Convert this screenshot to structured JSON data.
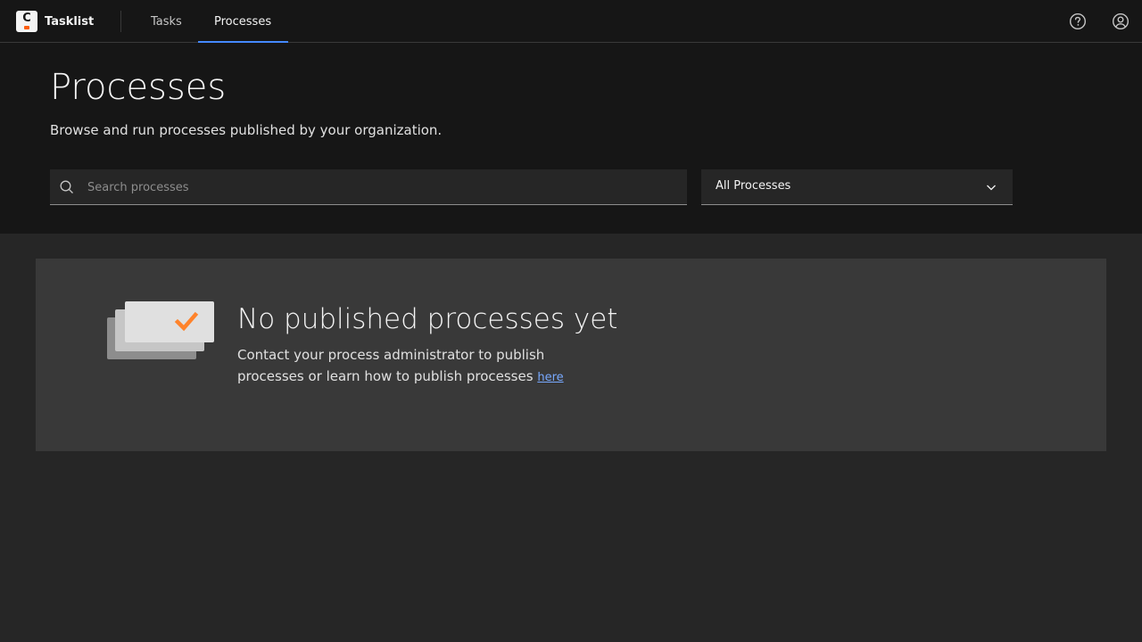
{
  "header": {
    "brand_letter": "C",
    "brand_name": "Tasklist",
    "tabs": [
      {
        "label": "Tasks",
        "active": false
      },
      {
        "label": "Processes",
        "active": true
      }
    ],
    "help_icon": "help-circle-icon",
    "user_icon": "user-avatar-icon"
  },
  "title_section": {
    "title": "Processes",
    "subtitle": "Browse and run processes published by your organization.",
    "search": {
      "placeholder": "Search processes",
      "value": ""
    },
    "filter": {
      "selected": "All Processes"
    }
  },
  "empty_state": {
    "title": "No published processes yet",
    "description": "Contact your process administrator to publish processes or learn how to publish processes",
    "link_text": "here"
  },
  "colors": {
    "accent": "#4589ff",
    "brand_orange": "#fc5d0d",
    "check_orange": "#ff832b",
    "link": "#78a9ff"
  }
}
